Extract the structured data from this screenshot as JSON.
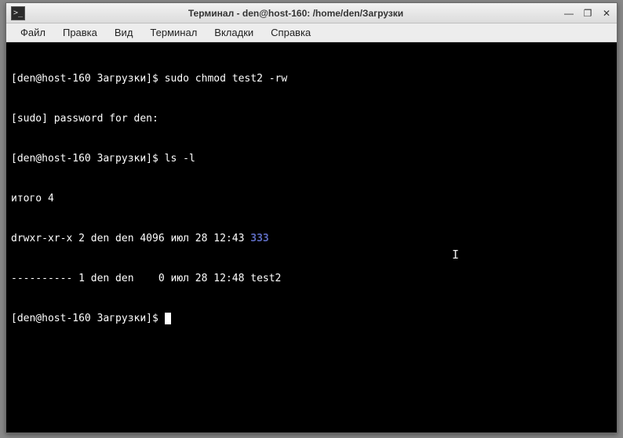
{
  "titlebar": {
    "icon_glyph": ">_",
    "title": "Терминал - den@host-160: /home/den/Загрузки",
    "minimize": "—",
    "maximize": "❐",
    "close": "✕"
  },
  "menubar": {
    "items": [
      {
        "label": "Файл"
      },
      {
        "label": "Правка"
      },
      {
        "label": "Вид"
      },
      {
        "label": "Терминал"
      },
      {
        "label": "Вкладки"
      },
      {
        "label": "Справка"
      }
    ]
  },
  "terminal": {
    "lines": [
      {
        "prompt": "[den@host-160 Загрузки]$ ",
        "cmd": "sudo chmod test2 -rw"
      },
      {
        "text": "[sudo] password for den: "
      },
      {
        "prompt": "[den@host-160 Загрузки]$ ",
        "cmd": "ls -l"
      },
      {
        "text": "итого 4"
      },
      {
        "text": "drwxr-xr-x 2 den den 4096 июл 28 12:43 ",
        "link": "333"
      },
      {
        "text": "---------- 1 den den    0 июл 28 12:48 test2"
      },
      {
        "prompt": "[den@host-160 Загрузки]$ ",
        "cursor": true
      }
    ]
  }
}
